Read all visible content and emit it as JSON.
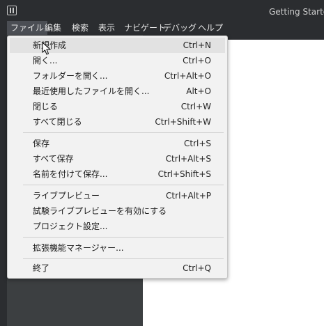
{
  "window": {
    "title": "Getting Started"
  },
  "menubar": [
    {
      "label": "ファイル"
    },
    {
      "label": "編集"
    },
    {
      "label": "検索"
    },
    {
      "label": "表示"
    },
    {
      "label": "ナビゲート"
    },
    {
      "label": "デバッグ"
    },
    {
      "label": "ヘルプ"
    }
  ],
  "file_menu": {
    "items": [
      {
        "label": "新規作成",
        "shortcut": "Ctrl+N"
      },
      {
        "label": "開く...",
        "shortcut": "Ctrl+O"
      },
      {
        "label": "フォルダーを開く...",
        "shortcut": "Ctrl+Alt+O"
      },
      {
        "label": "最近使用したファイルを開く...",
        "shortcut": "Alt+O"
      },
      {
        "label": "閉じる",
        "shortcut": "Ctrl+W"
      },
      {
        "label": "すべて閉じる",
        "shortcut": "Ctrl+Shift+W"
      },
      {
        "label": "保存",
        "shortcut": "Ctrl+S"
      },
      {
        "label": "すべて保存",
        "shortcut": "Ctrl+Alt+S"
      },
      {
        "label": "名前を付けて保存...",
        "shortcut": "Ctrl+Shift+S"
      },
      {
        "label": "ライブプレビュー",
        "shortcut": "Ctrl+Alt+P"
      },
      {
        "label": "試験ライブプレビューを有効にする",
        "shortcut": ""
      },
      {
        "label": "プロジェクト設定...",
        "shortcut": ""
      },
      {
        "label": "拡張機能マネージャー...",
        "shortcut": ""
      },
      {
        "label": "終了",
        "shortcut": "Ctrl+Q"
      }
    ]
  },
  "colors": {
    "chrome": "#2b2d30",
    "menu_background": "#f2f2f2",
    "menu_hover": "#e2e2e2",
    "editor": "#ffffff"
  }
}
